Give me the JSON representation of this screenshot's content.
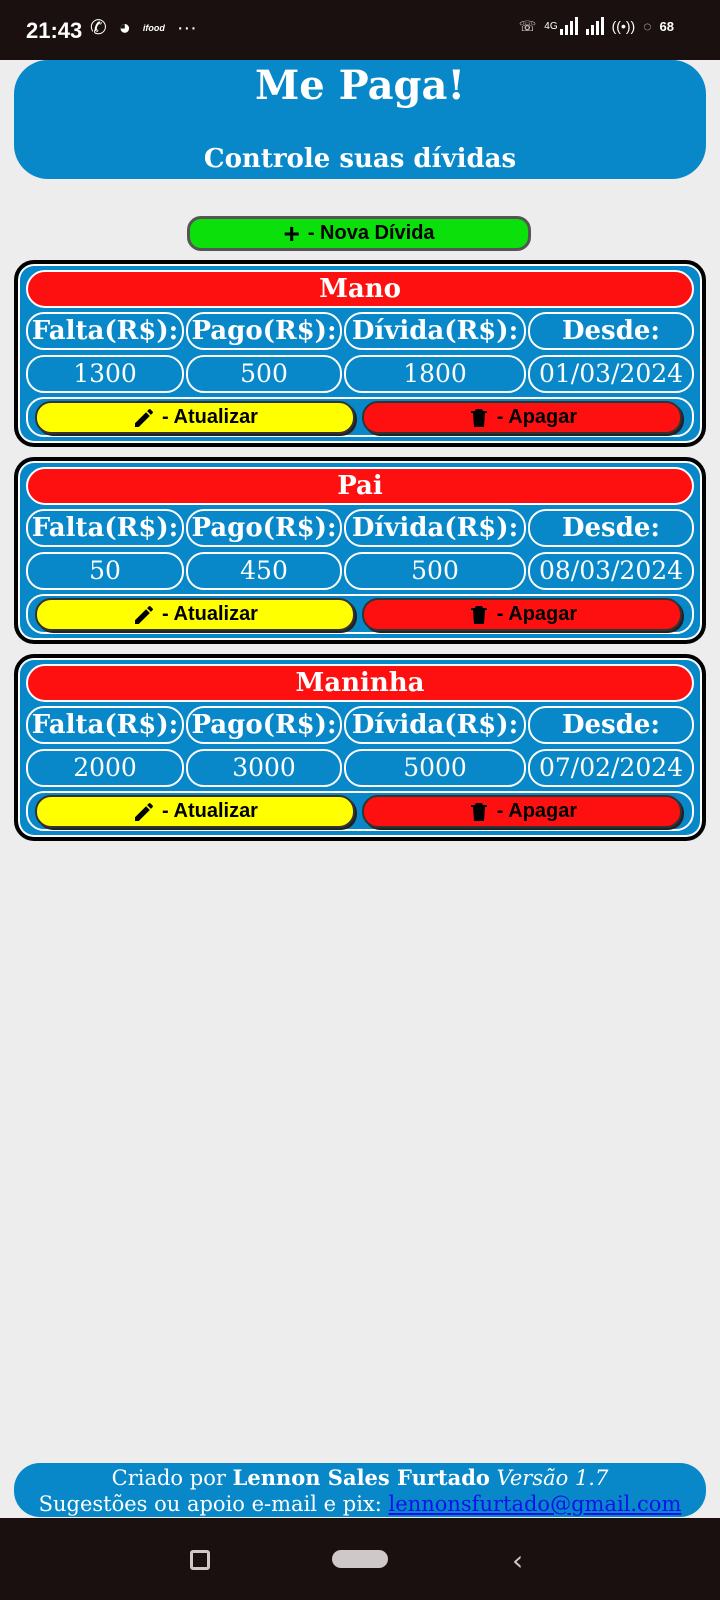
{
  "status_bar": {
    "time": "21:43",
    "network": "4G",
    "battery": "68"
  },
  "header": {
    "title": "Me Paga!",
    "subtitle": "Controle suas dívidas"
  },
  "new_debt_button": {
    "icon": "plus-icon",
    "label": "- Nova Dívida"
  },
  "columns": {
    "falta": "Falta(R$):",
    "pago": "Pago(R$):",
    "divida": "Dívida(R$):",
    "desde": "Desde:"
  },
  "actions": {
    "update_label": "- Atualizar",
    "delete_label": "- Apagar",
    "update_icon": "pencil-icon",
    "delete_icon": "trash-icon"
  },
  "debts": [
    {
      "name": "Mano",
      "falta": "1300",
      "pago": "500",
      "divida": "1800",
      "desde": "01/03/2024"
    },
    {
      "name": "Pai",
      "falta": "50",
      "pago": "450",
      "divida": "500",
      "desde": "08/03/2024"
    },
    {
      "name": "Maninha",
      "falta": "2000",
      "pago": "3000",
      "divida": "5000",
      "desde": "07/02/2024"
    }
  ],
  "footer": {
    "created_by": "Criado por",
    "author": "Lennon Sales Furtado",
    "version": "Versão 1.7",
    "support_text": "Sugestões ou apoio e-mail e pix:",
    "email": "lennonsfurtado@gmail.com"
  },
  "colors": {
    "header_blue": "#0888c8",
    "card_name_red": "#ff1010",
    "new_button_green": "#0be00b",
    "update_yellow": "#ffff00",
    "delete_red": "#ff1010",
    "background": "#ededed"
  }
}
